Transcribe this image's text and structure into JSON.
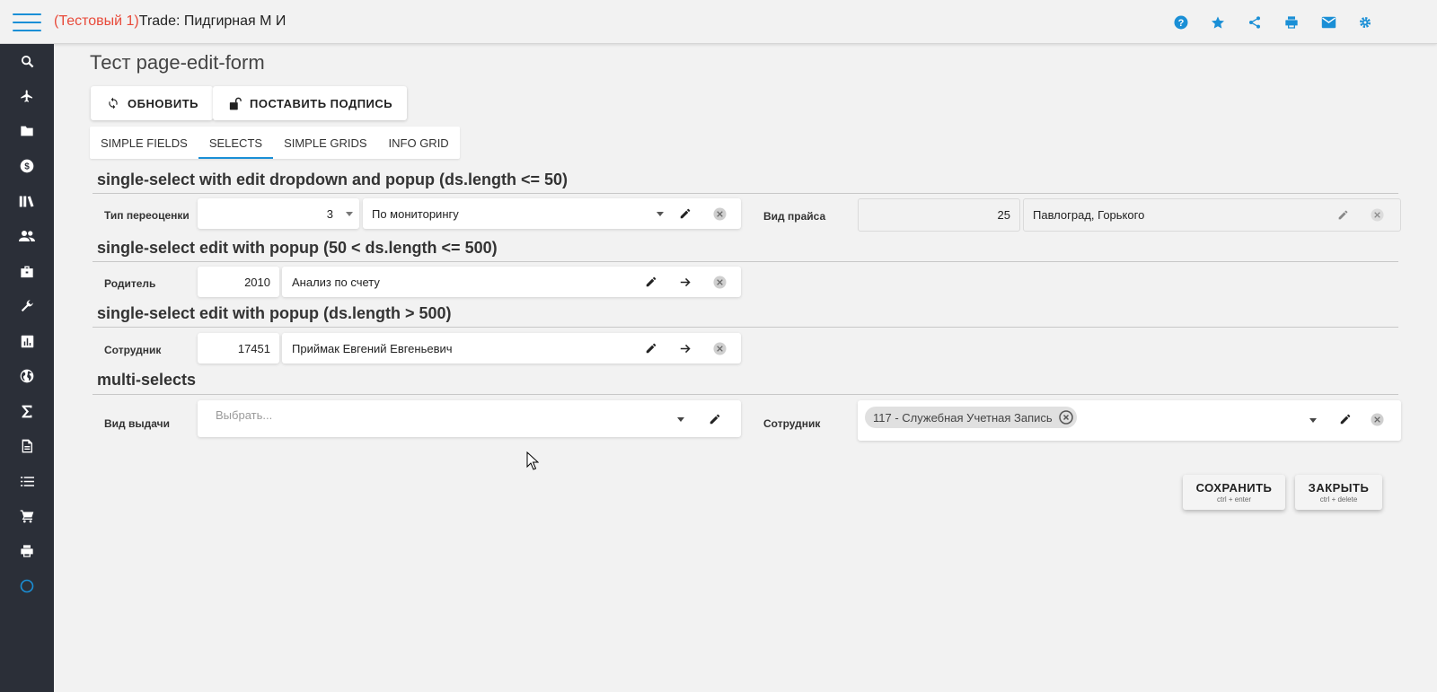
{
  "header": {
    "test_prefix": "(Тестовый 1)",
    "title": "Trade: Пидгирная М И",
    "accent_color": "#1a8fd6",
    "test_color": "#e84a3a",
    "icons": [
      "help-icon",
      "star-icon",
      "share-icon",
      "print-icon",
      "mail-icon",
      "settings-icon"
    ]
  },
  "sidebar": {
    "background": "#2b2f38",
    "items": [
      "search-icon",
      "airplane-icon",
      "folder-icon",
      "dollar-icon",
      "library-icon",
      "people-icon",
      "briefcase-icon",
      "wrench-icon",
      "chart-icon",
      "globe-icon",
      "sigma-icon",
      "document-icon",
      "list-icon",
      "cart-icon",
      "print-icon",
      "circle-icon"
    ]
  },
  "page": {
    "title": "Тест page-edit-form",
    "refresh_label": "ОБНОВИТЬ",
    "sign_label": "ПОСТАВИТЬ ПОДПИСЬ"
  },
  "tabs": [
    {
      "label": "SIMPLE FIELDS",
      "active": false
    },
    {
      "label": "SELECTS",
      "active": true
    },
    {
      "label": "SIMPLE GRIDS",
      "active": false
    },
    {
      "label": "INFO GRID",
      "active": false
    }
  ],
  "sections": {
    "s1": "single-select with edit dropdown and popup (ds.length <= 50)",
    "s2": "single-select edit with popup (50 < ds.length <= 500)",
    "s3": "single-select edit with popup (ds.length > 500)",
    "s4": "multi-selects"
  },
  "fields": {
    "reval_type": {
      "label": "Тип переоценки",
      "code": "3",
      "value": "По мониторингу"
    },
    "price_type": {
      "label": "Вид прайса",
      "code": "25",
      "value": "Павлоград, Горького"
    },
    "parent": {
      "label": "Родитель",
      "code": "2010",
      "value": "Анализ по счету"
    },
    "employee": {
      "label": "Сотрудник",
      "code": "17451",
      "value": "Приймак Евгений Евгеньевич"
    },
    "issue_type": {
      "label": "Вид выдачи",
      "placeholder": "Выбрать..."
    },
    "employee_multi": {
      "label": "Сотрудник",
      "chip": "117 - Служебная Учетная Запись"
    }
  },
  "footer": {
    "save_label": "СОХРАНИТЬ",
    "save_hint": "ctrl + enter",
    "close_label": "ЗАКРЫТЬ",
    "close_hint": "ctrl + delete"
  }
}
